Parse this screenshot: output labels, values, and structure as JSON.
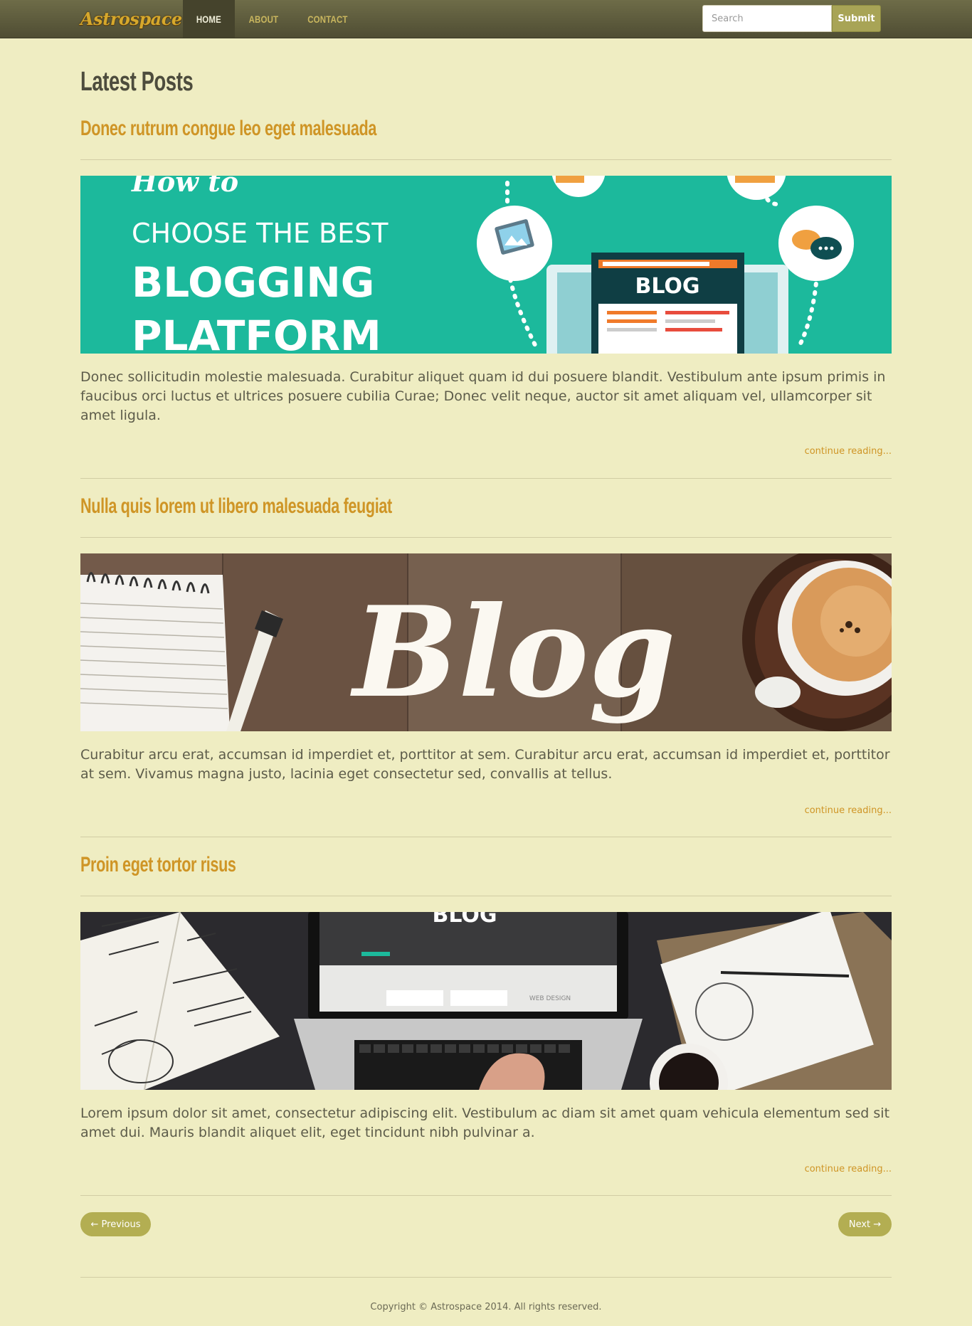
{
  "nav": {
    "brand": "Astrospace",
    "items": [
      {
        "label": "HOME",
        "active": true
      },
      {
        "label": "ABOUT",
        "active": false
      },
      {
        "label": "CONTACT",
        "active": false
      }
    ],
    "search_placeholder": "Search",
    "submit_label": "Submit"
  },
  "page_title": "Latest Posts",
  "posts": [
    {
      "title": "Donec rutrum congue leo eget malesuada",
      "image": {
        "line1": "How to",
        "line2": "CHOOSE THE BEST",
        "line3": "BLOGGING",
        "line4": "PLATFORM",
        "badge": "BLOG"
      },
      "excerpt": "Donec sollicitudin molestie malesuada. Curabitur aliquet quam id dui posuere blandit. Vestibulum ante ipsum primis in faucibus orci luctus et ultrices posuere cubilia Curae; Donec velit neque, auctor sit amet aliquam vel, ullamcorper sit amet ligula.",
      "continue_label": "continue reading..."
    },
    {
      "title": "Nulla quis lorem ut libero malesuada feugiat",
      "image": {
        "script_text": "Blog"
      },
      "excerpt": "Curabitur arcu erat, accumsan id imperdiet et, porttitor at sem. Curabitur arcu erat, accumsan id imperdiet et, porttitor at sem. Vivamus magna justo, lacinia eget consectetur sed, convallis at tellus.",
      "continue_label": "continue reading..."
    },
    {
      "title": "Proin eget tortor risus",
      "image": {
        "screen_text": "BLOG",
        "web_label": "WEB DESIGN"
      },
      "excerpt": "Lorem ipsum dolor sit amet, consectetur adipiscing elit. Vestibulum ac diam sit amet quam vehicula elementum sed sit amet dui. Mauris blandit aliquet elit, eget tincidunt nibh pulvinar a.",
      "continue_label": "continue reading..."
    }
  ],
  "pager": {
    "previous": "← Previous",
    "next": "Next →"
  },
  "footer": "Copyright © Astrospace 2014. All rights reserved.",
  "colors": {
    "background": "#efedc2",
    "accent": "#cf9526",
    "navbar": "#5f5d3e",
    "button": "#b3ae52"
  }
}
